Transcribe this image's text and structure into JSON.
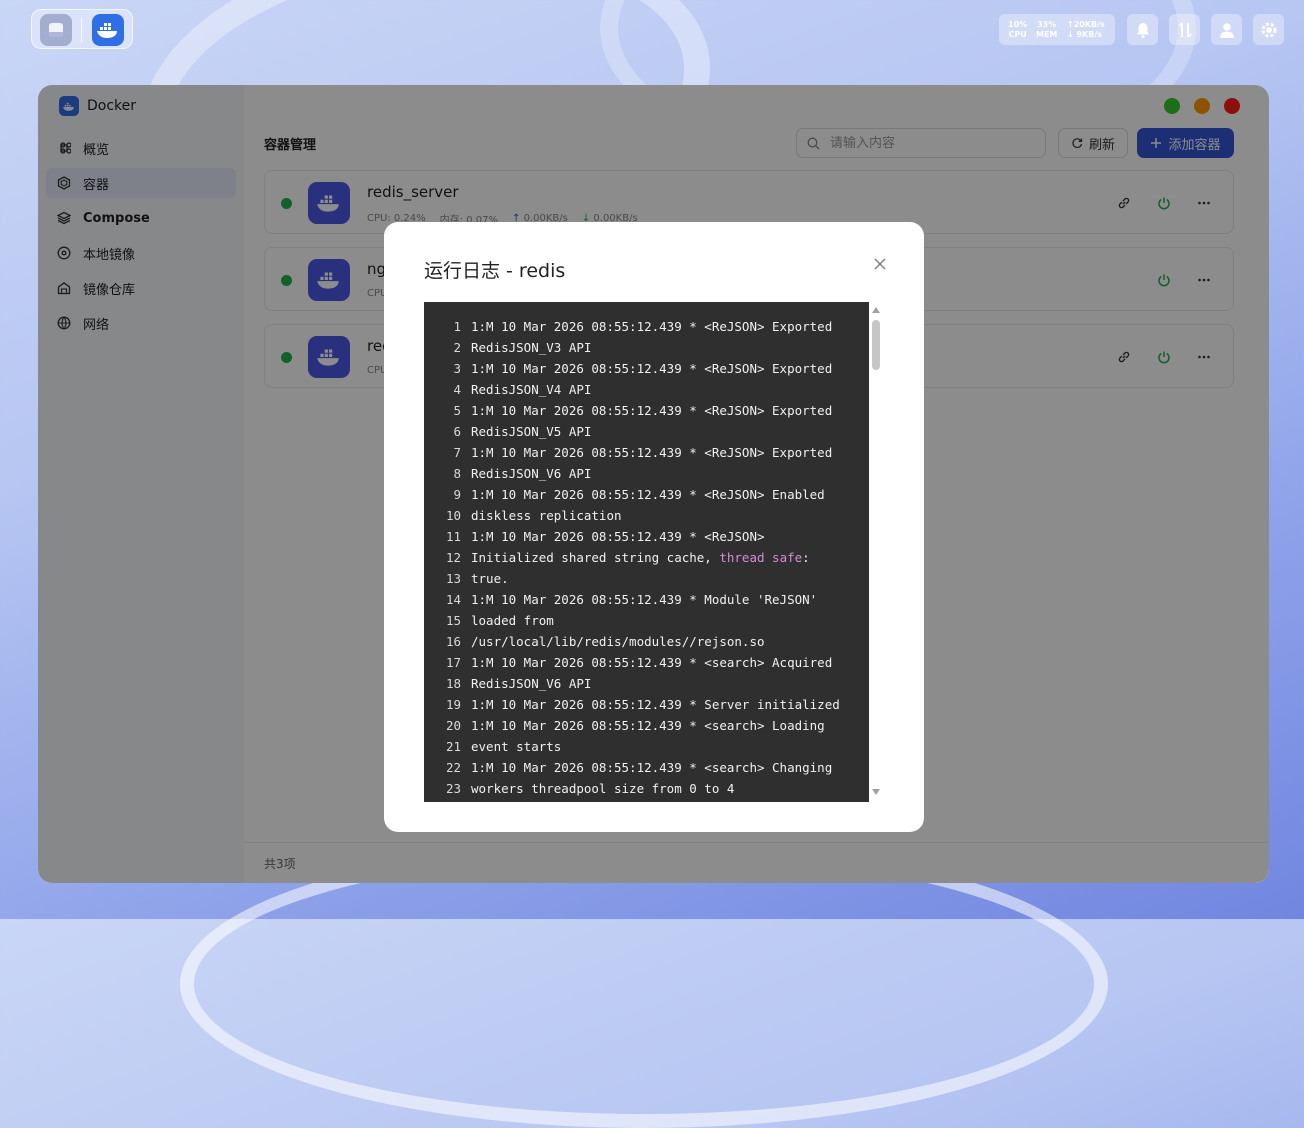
{
  "topbar": {
    "cpu_value": "10%",
    "cpu_label": "CPU",
    "mem_value": "33%",
    "mem_label": "MEM",
    "net_up": "↑20KB/s",
    "net_down": "↓ 9KB/s",
    "icons": [
      "files-app-icon",
      "docker-app-icon",
      "bell-icon",
      "transfer-icon",
      "user-icon",
      "gear-icon"
    ]
  },
  "window": {
    "brand": "Docker",
    "traffic_colors": [
      "#34c92b",
      "#ff9a00",
      "#ff1a1a"
    ],
    "nav": [
      {
        "label": "概览",
        "icon": "command-icon"
      },
      {
        "label": "容器",
        "icon": "hexagon-icon"
      },
      {
        "label": "Compose",
        "icon": "layers-icon"
      },
      {
        "label": "本地镜像",
        "icon": "disc-icon"
      },
      {
        "label": "镜像仓库",
        "icon": "warehouse-icon"
      },
      {
        "label": "网络",
        "icon": "globe-icon"
      }
    ],
    "active_nav": "容器",
    "section_title": "容器管理",
    "search_placeholder": "请输入内容",
    "refresh_label": "刷新",
    "add_label": "添加容器",
    "containers": [
      {
        "name": "redis_server",
        "cpu": "CPU: 0.24%",
        "mem": "内存: 0.07%",
        "up": "0.00KB/s",
        "down": "0.00KB/s"
      },
      {
        "name": "ng",
        "cpu": "CPU",
        "mem": "",
        "up": "",
        "down": ""
      },
      {
        "name": "rec",
        "cpu": "CPU",
        "mem": "",
        "up": "",
        "down": ""
      }
    ],
    "footer_count": "共3项"
  },
  "modal": {
    "title": "运行日志 - redis",
    "lines": [
      {
        "n": "1",
        "t": "1:M 10 Mar 2026 08:55:12.439 * <ReJSON> Exported"
      },
      {
        "n": "2",
        "t": "RedisJSON_V3 API"
      },
      {
        "n": "3",
        "t": "1:M 10 Mar 2026 08:55:12.439 * <ReJSON> Exported"
      },
      {
        "n": "4",
        "t": "RedisJSON_V4 API"
      },
      {
        "n": "5",
        "t": "1:M 10 Mar 2026 08:55:12.439 * <ReJSON> Exported"
      },
      {
        "n": "6",
        "t": "RedisJSON_V5 API"
      },
      {
        "n": "7",
        "t": "1:M 10 Mar 2026 08:55:12.439 * <ReJSON> Exported"
      },
      {
        "n": "8",
        "t": "RedisJSON_V6 API"
      },
      {
        "n": "9",
        "t": "1:M 10 Mar 2026 08:55:12.439 * <ReJSON> Enabled"
      },
      {
        "n": "10",
        "t": "diskless replication"
      },
      {
        "n": "11",
        "t": "1:M 10 Mar 2026 08:55:12.439 * <ReJSON>"
      },
      {
        "n": "12",
        "t": "Initialized shared string cache, ",
        "hl": "thread safe",
        "after": ":"
      },
      {
        "n": "13",
        "t": "true."
      },
      {
        "n": "14",
        "t": "1:M 10 Mar 2026 08:55:12.439 * Module 'ReJSON'"
      },
      {
        "n": "15",
        "t": "loaded from"
      },
      {
        "n": "16",
        "t": "/usr/local/lib/redis/modules//rejson.so"
      },
      {
        "n": "17",
        "t": "1:M 10 Mar 2026 08:55:12.439 * <search> Acquired"
      },
      {
        "n": "18",
        "t": "RedisJSON_V6 API"
      },
      {
        "n": "19",
        "t": "1:M 10 Mar 2026 08:55:12.439 * Server initialized"
      },
      {
        "n": "20",
        "t": "1:M 10 Mar 2026 08:55:12.439 * <search> Loading"
      },
      {
        "n": "21",
        "t": "event starts"
      },
      {
        "n": "22",
        "t": "1:M 10 Mar 2026 08:55:12.439 * <search> Changing"
      },
      {
        "n": "23",
        "t": "workers threadpool size from 0 to 4"
      }
    ]
  }
}
